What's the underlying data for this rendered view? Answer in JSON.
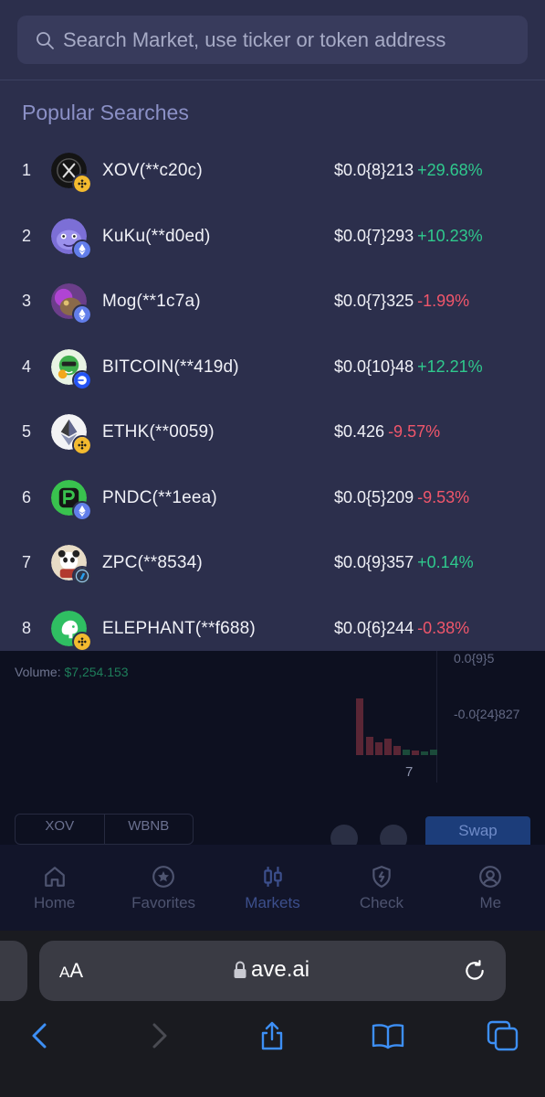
{
  "search": {
    "placeholder": "Search Market, use ticker or token address"
  },
  "popular_title": "Popular Searches",
  "popular": [
    {
      "rank": "1",
      "name": "XOV(**c20c)",
      "price": "$0.0{8}213",
      "change": "+29.68%",
      "direction": "up",
      "icon": "x-token-icon",
      "chain": "bnb-chain-icon"
    },
    {
      "rank": "2",
      "name": "KuKu(**d0ed)",
      "price": "$0.0{7}293",
      "change": "+10.23%",
      "direction": "up",
      "icon": "kuku-token-icon",
      "chain": "eth-chain-icon"
    },
    {
      "rank": "3",
      "name": "Mog(**1c7a)",
      "price": "$0.0{7}325",
      "change": "-1.99%",
      "direction": "down",
      "icon": "mog-token-icon",
      "chain": "eth-chain-icon"
    },
    {
      "rank": "4",
      "name": "BITCOIN(**419d)",
      "price": "$0.0{10}48",
      "change": "+12.21%",
      "direction": "up",
      "icon": "bitcoin-meme-token-icon",
      "chain": "base-chain-icon"
    },
    {
      "rank": "5",
      "name": "ETHK(**0059)",
      "price": "$0.426",
      "change": "-9.57%",
      "direction": "down",
      "icon": "eth-token-icon",
      "chain": "bnb-chain-icon"
    },
    {
      "rank": "6",
      "name": "PNDC(**1eea)",
      "price": "$0.0{5}209",
      "change": "-9.53%",
      "direction": "down",
      "icon": "pndc-token-icon",
      "chain": "eth-chain-icon"
    },
    {
      "rank": "7",
      "name": "ZPC(**8534)",
      "price": "$0.0{9}357",
      "change": "+0.14%",
      "direction": "up",
      "icon": "zpc-panda-token-icon",
      "chain": "arbitrum-chain-icon"
    },
    {
      "rank": "8",
      "name": "ELEPHANT(**f688)",
      "price": "$0.0{6}244",
      "change": "-0.38%",
      "direction": "down",
      "icon": "elephant-token-icon",
      "chain": "bnb-chain-icon"
    }
  ],
  "background": {
    "volume_label": "Volume:",
    "volume_value": "$7,254.153",
    "y_labels": [
      "0.0{9}5",
      "-0.0{24}827"
    ],
    "x_label": "7",
    "pair": [
      "XOV",
      "WBNB"
    ],
    "swap_label": "Swap"
  },
  "tabs": [
    {
      "label": "Home",
      "icon": "home-icon",
      "active": false
    },
    {
      "label": "Favorites",
      "icon": "star-icon",
      "active": false
    },
    {
      "label": "Markets",
      "icon": "candlestick-icon",
      "active": true
    },
    {
      "label": "Check",
      "icon": "shield-check-icon",
      "active": false
    },
    {
      "label": "Me",
      "icon": "user-icon",
      "active": false
    }
  ],
  "browser": {
    "text_size_label_small": "A",
    "text_size_label_large": "A",
    "domain": "ave.ai"
  },
  "colors": {
    "up": "#2fc98d",
    "down": "#f0566b",
    "overlay_bg": "#2c2f4c",
    "accent": "#8b90c6",
    "browser_blue": "#3d8ff5"
  }
}
